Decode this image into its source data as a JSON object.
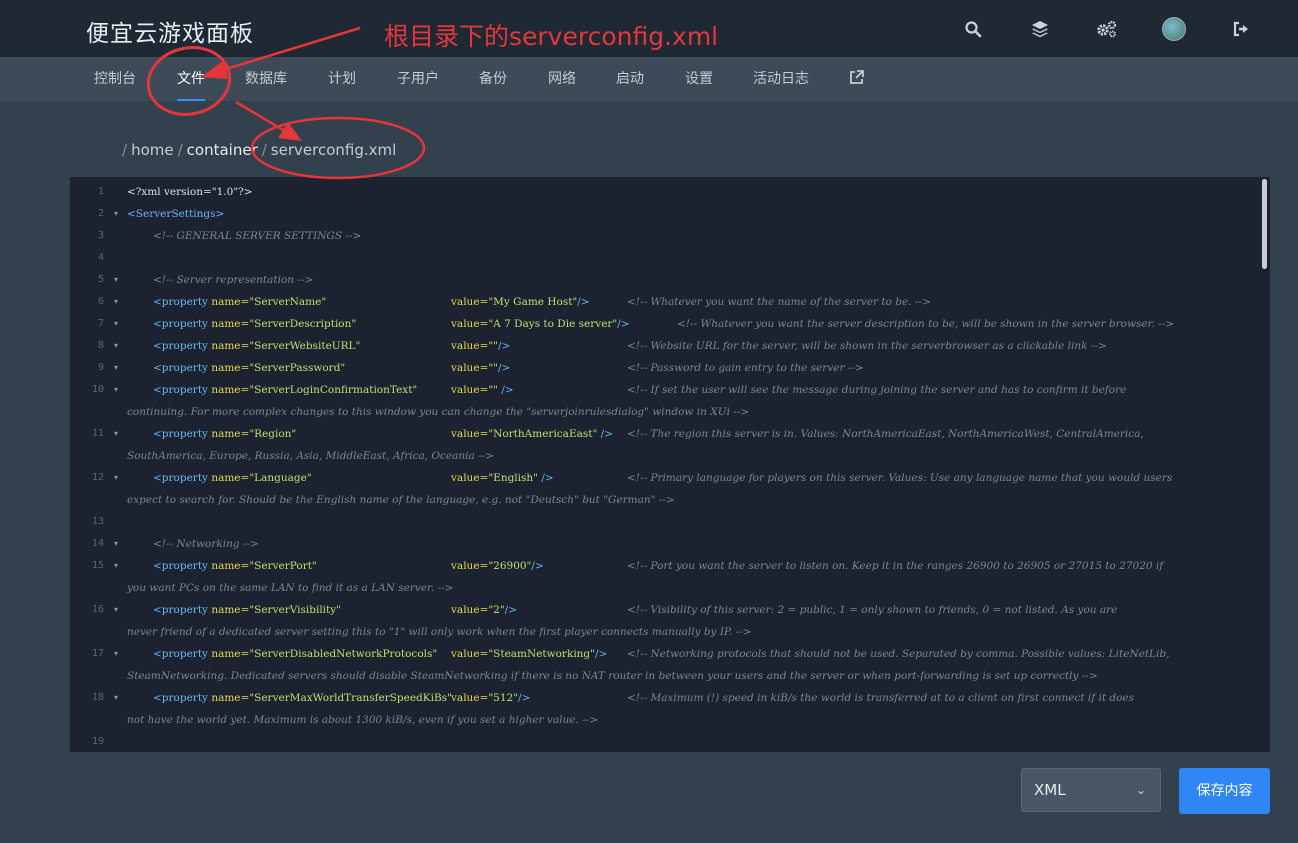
{
  "app": {
    "brand": "便宜云游戏面板"
  },
  "annotation": {
    "title": "根目录下的serverconfig.xml"
  },
  "header_icons": [
    "search-icon",
    "layers-icon",
    "gears-icon",
    "avatar",
    "logout-icon"
  ],
  "nav": {
    "tabs": [
      {
        "label": "控制台"
      },
      {
        "label": "文件",
        "active": true
      },
      {
        "label": "数据库"
      },
      {
        "label": "计划"
      },
      {
        "label": "子用户"
      },
      {
        "label": "备份"
      },
      {
        "label": "网络"
      },
      {
        "label": "启动"
      },
      {
        "label": "设置"
      },
      {
        "label": "活动日志"
      }
    ],
    "external_icon": "external-link-icon"
  },
  "breadcrumb": {
    "sep": "/",
    "home": "home",
    "container": "container",
    "file": "serverconfig.xml"
  },
  "editor": {
    "lines": [
      {
        "n": "1",
        "plain": "<?xml version=\"1.0\"?>"
      },
      {
        "n": "2",
        "tag": "<ServerSettings>"
      },
      {
        "n": "3",
        "comment": "<!-- GENERAL SERVER SETTINGS -->"
      },
      {
        "n": "4"
      },
      {
        "n": "5",
        "comment": "<!-- Server representation -->"
      },
      {
        "n": "6",
        "name": "\"ServerName\"",
        "value": "\"My Game Host\"",
        "close": "/>",
        "comment": "<!-- Whatever you want the name of the server to be. -->"
      },
      {
        "n": "7",
        "name": "\"ServerDescription\"",
        "value": "\"A 7 Days to Die server\"",
        "close": "/>",
        "comment": "<!-- Whatever you want the server description to be, will be shown in the server browser. -->"
      },
      {
        "n": "8",
        "name": "\"ServerWebsiteURL\"",
        "value": "\"\"",
        "close": "/>",
        "comment": "<!-- Website URL for the server, will be shown in the serverbrowser as a clickable link -->"
      },
      {
        "n": "9",
        "name": "\"ServerPassword\"",
        "value": "\"\"",
        "close": "/>",
        "comment": "<!-- Password to gain entry to the server -->"
      },
      {
        "n": "10",
        "name": "\"ServerLoginConfirmationText\"",
        "value": "\"\"",
        "close": " />",
        "comment": "<!-- If set the user will see the message during joining the server and has to confirm it before",
        "cont": "continuing. For more complex changes to this window you can change the \"serverjoinrulesdialog\" window in XUi -->"
      },
      {
        "n": "11",
        "name": "\"Region\"",
        "value": "\"NorthAmericaEast\"",
        "close": " />",
        "comment": "<!-- The region this server is in. Values: NorthAmericaEast, NorthAmericaWest, CentralAmerica,",
        "cont": "SouthAmerica, Europe, Russia, Asia, MiddleEast, Africa, Oceania -->"
      },
      {
        "n": "12",
        "name": "\"Language\"",
        "value": "\"English\"",
        "close": " />",
        "comment": "<!-- Primary language for players on this server. Values: Use any language name that you would users",
        "cont": "expect to search for. Should be the English name of the language, e.g. not \"Deutsch\" but \"German\" -->"
      },
      {
        "n": "13"
      },
      {
        "n": "14",
        "comment": "<!-- Networking -->"
      },
      {
        "n": "15",
        "name": "\"ServerPort\"",
        "value": "\"26900\"",
        "close": "/>",
        "comment": "<!-- Port you want the server to listen on. Keep it in the ranges 26900 to 26905 or 27015 to 27020 if",
        "cont": "you want PCs on the same LAN to find it as a LAN server. -->"
      },
      {
        "n": "16",
        "name": "\"ServerVisibility\"",
        "value": "\"2\"",
        "close": "/>",
        "comment": "<!-- Visibility of this server: 2 = public, 1 = only shown to friends, 0 = not listed. As you are",
        "cont": "never friend of a dedicated server setting this to \"1\" will only work when the first player connects manually by IP. -->"
      },
      {
        "n": "17",
        "name": "\"ServerDisabledNetworkProtocols\"",
        "value": "\"SteamNetworking\"",
        "close": "/>",
        "comment": "<!-- Networking protocols that should not be used. Separated by comma. Possible values: LiteNetLib,",
        "cont": "SteamNetworking. Dedicated servers should disable SteamNetworking if there is no NAT router in between your users and the server or when port-forwarding is set up correctly -->"
      },
      {
        "n": "18",
        "name": "\"ServerMaxWorldTransferSpeedKiBs\"",
        "value": "\"512\"",
        "close": "/>",
        "comment": "<!-- Maximum (!) speed in kiB/s the world is transferred at to a client on first connect if it does",
        "cont": "not have the world yet. Maximum is about 1300 kiB/s, even if you set a higher value. -->"
      },
      {
        "n": "19"
      }
    ]
  },
  "footer": {
    "mode": "XML",
    "save_label": "保存内容"
  }
}
